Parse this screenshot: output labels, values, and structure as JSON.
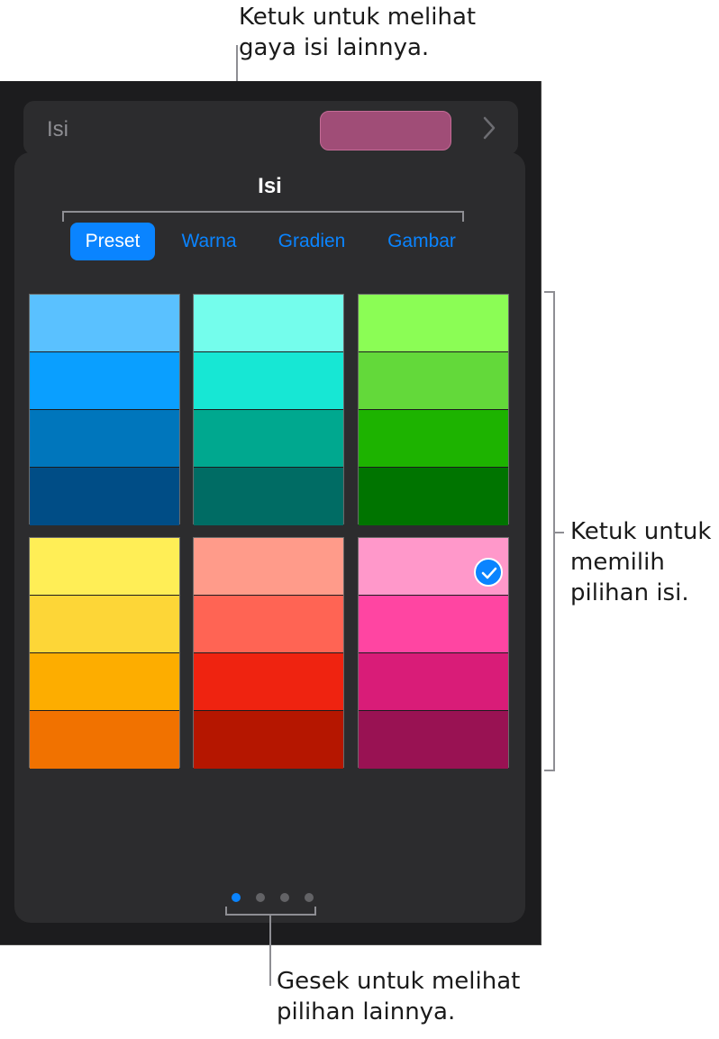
{
  "callouts": {
    "top": [
      "Ketuk untuk melihat",
      "gaya isi lainnya."
    ],
    "right": [
      "Ketuk untuk",
      "memilih",
      "pilihan isi."
    ],
    "bottom": [
      "Gesek untuk melihat",
      "pilihan lainnya."
    ]
  },
  "fill_row": {
    "label": "Isi",
    "swatch_color": "#a04d77",
    "chevron_icon": "chevron-right-icon"
  },
  "popover": {
    "title": "Isi",
    "tabs": [
      {
        "label": "Preset",
        "active": true
      },
      {
        "label": "Warna",
        "active": false
      },
      {
        "label": "Gradien",
        "active": false
      },
      {
        "label": "Gambar",
        "active": false
      }
    ],
    "selected_preset": "pink",
    "presets": [
      {
        "name": "blue",
        "colors": [
          "#5ac1ff",
          "#0a9fff",
          "#0076bc",
          "#004d86"
        ]
      },
      {
        "name": "teal",
        "colors": [
          "#74fdec",
          "#17e7d4",
          "#00a88f",
          "#006c64"
        ]
      },
      {
        "name": "green",
        "colors": [
          "#8bfd55",
          "#63d93a",
          "#1db300",
          "#007400"
        ]
      },
      {
        "name": "yellow",
        "colors": [
          "#ffee56",
          "#fdd637",
          "#fdad00",
          "#f17200"
        ]
      },
      {
        "name": "red",
        "colors": [
          "#ff9b8a",
          "#ff6454",
          "#ef2310",
          "#b51600"
        ]
      },
      {
        "name": "pink",
        "colors": [
          "#ff98ca",
          "#ff45a2",
          "#d91c78",
          "#991253"
        ]
      }
    ],
    "page_dots": {
      "count": 4,
      "active_index": 0
    }
  },
  "colors": {
    "accent": "#0a84ff",
    "panel": "#2c2c2e",
    "background": "#1c1c1e"
  }
}
